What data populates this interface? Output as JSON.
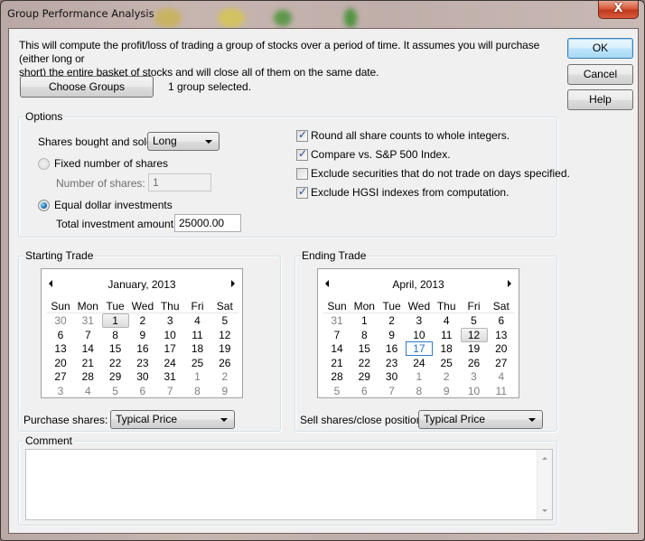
{
  "window": {
    "title": "Group Performance Analysis",
    "close_glyph": "X"
  },
  "intro": {
    "line1": "This will compute the profit/loss of trading a group of stocks over a period of time.  It assumes you will purchase (either long or",
    "line2": "short) the entire basket of stocks and will close all of them on the same date."
  },
  "groups": {
    "choose_label": "Choose Groups",
    "status": "1 group selected."
  },
  "actions": {
    "ok": "OK",
    "cancel": "Cancel",
    "help": "Help"
  },
  "options": {
    "title": "Options",
    "shares_label": "Shares bought and sold:",
    "shares_value": "Long",
    "fixed": {
      "label": "Fixed number of shares",
      "selected": false,
      "enabled": false
    },
    "number_label": "Number of shares:",
    "number_value": "1",
    "equal": {
      "label": "Equal dollar investments",
      "selected": true
    },
    "total_label": "Total investment amount:",
    "total_value": "25000.00",
    "checkboxes": [
      {
        "label": "Round all share counts to whole integers.",
        "checked": true
      },
      {
        "label": "Compare vs. S&P 500 Index.",
        "checked": true
      },
      {
        "label": "Exclude securities that do not trade on days specified.",
        "checked": false
      },
      {
        "label": "Exclude HGSI indexes from computation.",
        "checked": true
      }
    ]
  },
  "start": {
    "title": "Starting Trade",
    "month": "January, 2013",
    "dow": [
      "Sun",
      "Mon",
      "Tue",
      "Wed",
      "Thu",
      "Fri",
      "Sat"
    ],
    "days": [
      [
        "30",
        "31",
        "1",
        "2",
        "3",
        "4",
        "5"
      ],
      [
        "6",
        "7",
        "8",
        "9",
        "10",
        "11",
        "12"
      ],
      [
        "13",
        "14",
        "15",
        "16",
        "17",
        "18",
        "19"
      ],
      [
        "20",
        "21",
        "22",
        "23",
        "24",
        "25",
        "26"
      ],
      [
        "27",
        "28",
        "29",
        "30",
        "31",
        "1",
        "2"
      ],
      [
        "3",
        "4",
        "5",
        "6",
        "7",
        "8",
        "9"
      ]
    ],
    "first_in_month_index": 2,
    "days_in_month": 31,
    "selected_day": "1",
    "today_day": null,
    "price_label": "Purchase shares:",
    "price_value": "Typical Price"
  },
  "end": {
    "title": "Ending Trade",
    "month": "April, 2013",
    "dow": [
      "Sun",
      "Mon",
      "Tue",
      "Wed",
      "Thu",
      "Fri",
      "Sat"
    ],
    "days": [
      [
        "31",
        "1",
        "2",
        "3",
        "4",
        "5",
        "6"
      ],
      [
        "7",
        "8",
        "9",
        "10",
        "11",
        "12",
        "13"
      ],
      [
        "14",
        "15",
        "16",
        "17",
        "18",
        "19",
        "20"
      ],
      [
        "21",
        "22",
        "23",
        "24",
        "25",
        "26",
        "27"
      ],
      [
        "28",
        "29",
        "30",
        "1",
        "2",
        "3",
        "4"
      ],
      [
        "5",
        "6",
        "7",
        "8",
        "9",
        "10",
        "11"
      ]
    ],
    "first_in_month_index": 1,
    "days_in_month": 30,
    "selected_day": "12",
    "today_day": "17",
    "price_label": "Sell shares/close position:",
    "price_value": "Typical Price"
  },
  "comment": {
    "title": "Comment",
    "value": ""
  }
}
